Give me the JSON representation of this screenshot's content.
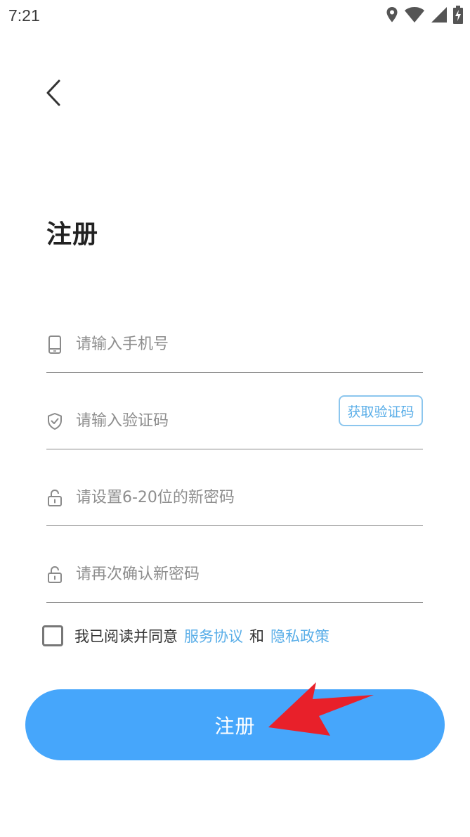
{
  "status_bar": {
    "time": "7:21",
    "icons": [
      "location-icon",
      "wifi-icon",
      "signal-icon",
      "battery-charging-icon"
    ]
  },
  "nav": {
    "back_icon": "chevron-left-icon"
  },
  "page": {
    "title": "注册"
  },
  "form": {
    "phone": {
      "placeholder": "请输入手机号",
      "value": "",
      "icon": "phone-icon"
    },
    "code": {
      "placeholder": "请输入验证码",
      "value": "",
      "icon": "shield-icon",
      "button_label": "获取验证码"
    },
    "password": {
      "placeholder": "请设置6-20位的新密码",
      "value": "",
      "icon": "lock-icon"
    },
    "confirm_password": {
      "placeholder": "请再次确认新密码",
      "value": "",
      "icon": "lock-icon"
    }
  },
  "agreement": {
    "checked": false,
    "prefix": "我已阅读并同意",
    "service_link": "服务协议",
    "and": "和",
    "privacy_link": "隐私政策"
  },
  "submit": {
    "label": "注册"
  },
  "colors": {
    "accent": "#46a6fb",
    "link": "#5aaee8",
    "annotation_arrow": "#e8202a"
  }
}
